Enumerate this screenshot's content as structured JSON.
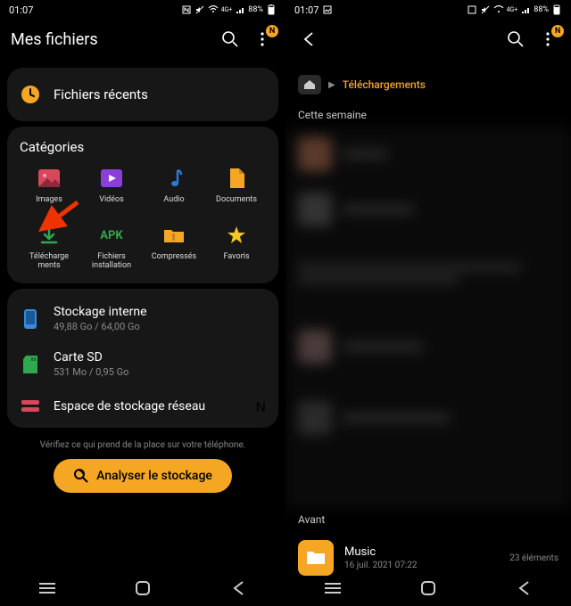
{
  "status": {
    "time": "01:07",
    "battery": "88%",
    "notif_badge": "N"
  },
  "left": {
    "title": "Mes fichiers",
    "recent": {
      "label": "Fichiers récents"
    },
    "categories": {
      "title": "Catégories",
      "items": [
        {
          "name": "Images",
          "icon": "image"
        },
        {
          "name": "Vidéos",
          "icon": "video"
        },
        {
          "name": "Audio",
          "icon": "audio"
        },
        {
          "name": "Documents",
          "icon": "document"
        },
        {
          "name": "Téléchargements",
          "icon": "download"
        },
        {
          "name": "Fichiers installation",
          "icon": "apk"
        },
        {
          "name": "Compressés",
          "icon": "zip"
        },
        {
          "name": "Favoris",
          "icon": "star"
        }
      ]
    },
    "storage": [
      {
        "name": "Stockage interne",
        "sub": "49,88 Go / 64,00 Go",
        "icon": "phone"
      },
      {
        "name": "Carte SD",
        "sub": "531 Mo / 0,95 Go",
        "icon": "sd"
      },
      {
        "name": "Espace de stockage réseau",
        "sub": "",
        "icon": "net",
        "badge": "N"
      }
    ],
    "tip": "Vérifiez ce qui prend de la place sur votre téléphone.",
    "analyze": "Analyser le stockage"
  },
  "right": {
    "breadcrumb": {
      "current": "Téléchargements"
    },
    "sections": {
      "this_week": "Cette semaine",
      "before": "Avant"
    },
    "file": {
      "name": "Music",
      "sub": "16 juil. 2021 07:22",
      "meta": "23 éléments"
    }
  },
  "colors": {
    "accent": "#f5a623"
  }
}
